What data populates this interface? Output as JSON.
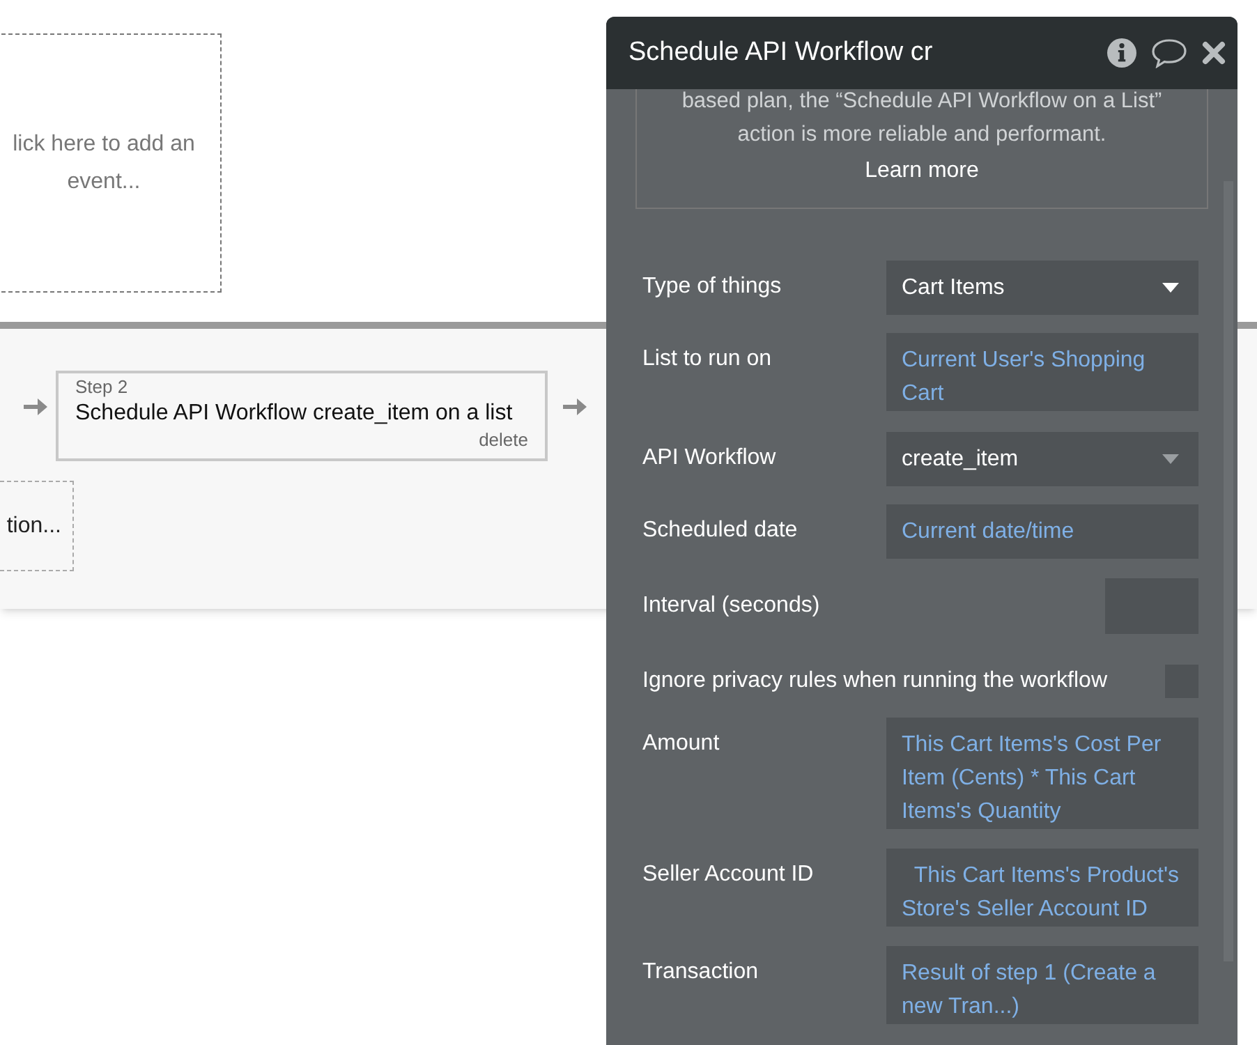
{
  "canvas": {
    "event_placeholder": "lick here to add an event...",
    "step": {
      "number": "Step 2",
      "title": "Schedule API Workflow create_item on a list",
      "delete": "delete"
    },
    "action_placeholder": "tion..."
  },
  "panel": {
    "title": "Schedule API Workflow cr",
    "notice": "based plan, the “Schedule API Workflow on a List” action is more reliable and performant.",
    "learn_more": "Learn more",
    "fields": [
      {
        "label": "Type of things",
        "kind": "dropdown",
        "value": "Cart Items"
      },
      {
        "label": "List to run on",
        "kind": "expression",
        "value": "Current User's Shopping Cart"
      },
      {
        "label": "API Workflow",
        "kind": "dropdown",
        "value": "create_item"
      },
      {
        "label": "Scheduled date",
        "kind": "expression",
        "value": "Current date/time"
      },
      {
        "label": "Interval (seconds)",
        "kind": "number"
      },
      {
        "label": "Ignore privacy rules when running the workflow",
        "kind": "checkbox",
        "checked": false
      },
      {
        "label": "Amount",
        "kind": "expression",
        "value": "This Cart Items's Cost Per Item (Cents) * This Cart Items's Quantity"
      },
      {
        "label": "Seller Account ID",
        "kind": "expression",
        "value": "  This Cart Items's Product's Store's Seller Account ID"
      },
      {
        "label": "Transaction",
        "kind": "expression",
        "value": "Result of step 1 (Create a new Tran...)"
      }
    ]
  }
}
